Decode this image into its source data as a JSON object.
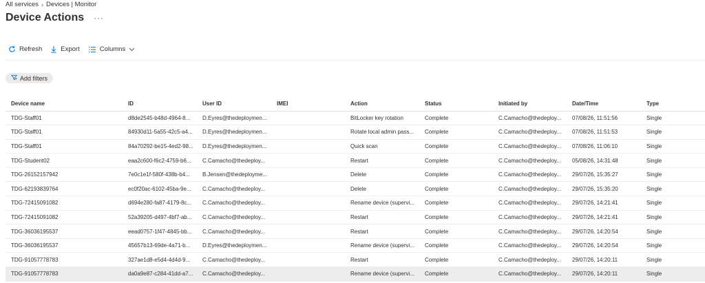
{
  "breadcrumb": {
    "root": "All services",
    "sep": "›",
    "current": "Devices | Monitor"
  },
  "header": {
    "title": "Device Actions",
    "more": "···"
  },
  "toolbar": {
    "refresh": "Refresh",
    "export": "Export",
    "columns": "Columns"
  },
  "filters": {
    "add_label": "Add filters"
  },
  "colors": {
    "accent": "#0078d4",
    "row_selected": "#ededed"
  },
  "table": {
    "columns": [
      "Device name",
      "ID",
      "User ID",
      "IMEI",
      "Action",
      "Status",
      "Initiated by",
      "Date/Time",
      "Type"
    ],
    "rows": [
      [
        "TDG-Staff01",
        "d8de2545-b48d-4964-8...",
        "D.Eyres@thedeploymen...",
        "",
        "BitLocker key rotation",
        "Complete",
        "C.Camacho@thedeploy...",
        "07/08/26, 11:51:56",
        "Single"
      ],
      [
        "TDG-Staff01",
        "84930d11-5a55-42c5-a4...",
        "D.Eyres@thedeploymen...",
        "",
        "Rotate local admin pass...",
        "Complete",
        "C.Camacho@thedeploy...",
        "07/08/26, 11:51:53",
        "Single"
      ],
      [
        "TDG-Staff01",
        "84a70292-be15-4ed2-98...",
        "D.Eyres@thedeploymen...",
        "",
        "Quick scan",
        "Complete",
        "C.Camacho@thedeploy...",
        "07/08/26, 11:06:10",
        "Single"
      ],
      [
        "TDG-Student02",
        "eaa2c600-f6c2-4759-b6...",
        "C.Camacho@thedeploy...",
        "",
        "Restart",
        "Complete",
        "C.Camacho@thedeploy...",
        "05/08/26, 14:31:48",
        "Single"
      ],
      [
        "TDG-26152157942",
        "7e0c1e1f-580f-438b-b4...",
        "B.Jensen@thedeployme...",
        "",
        "Delete",
        "Complete",
        "C.Camacho@thedeploy...",
        "29/07/26, 15:35:27",
        "Single"
      ],
      [
        "TDG-62193839764",
        "ec0f20ac-6102-45ba-9e...",
        "C.Camacho@thedeploy...",
        "",
        "Delete",
        "Complete",
        "C.Camacho@thedeploy...",
        "29/07/26, 15:35:20",
        "Single"
      ],
      [
        "TDG-72415091082",
        "d694e280-fa87-4179-8c...",
        "C.Camacho@thedeploy...",
        "",
        "Rename device (supervi...",
        "Complete",
        "C.Camacho@thedeploy...",
        "29/07/26, 14:21:41",
        "Single"
      ],
      [
        "TDG-72415091082",
        "52a39205-d497-4bf7-ab...",
        "C.Camacho@thedeploy...",
        "",
        "Restart",
        "Complete",
        "C.Camacho@thedeploy...",
        "29/07/26, 14:21:41",
        "Single"
      ],
      [
        "TDG-36036195537",
        "eead0757-1f47-4845-bb...",
        "C.Camacho@thedeploy...",
        "",
        "Restart",
        "Complete",
        "C.Camacho@thedeploy...",
        "29/07/26, 14:20:54",
        "Single"
      ],
      [
        "TDG-36036195537",
        "45657b13-69de-4a71-b...",
        "D.Eyres@thedeploymen...",
        "",
        "Rename device (supervi...",
        "Complete",
        "C.Camacho@thedeploy...",
        "29/07/26, 14:20:54",
        "Single"
      ],
      [
        "TDG-91057778783",
        "327ae1d8-e5d4-4d4d-9...",
        "C.Camacho@thedeploy...",
        "",
        "Restart",
        "Complete",
        "C.Camacho@thedeploy...",
        "29/07/26, 14:20:11",
        "Single"
      ],
      [
        "TDG-91057778783",
        "da0a9e87-c284-41dd-a7...",
        "C.Camacho@thedeploy...",
        "",
        "Rename device (supervi...",
        "Complete",
        "C.Camacho@thedeploy...",
        "29/07/26, 14:20:11",
        "Single"
      ]
    ]
  }
}
